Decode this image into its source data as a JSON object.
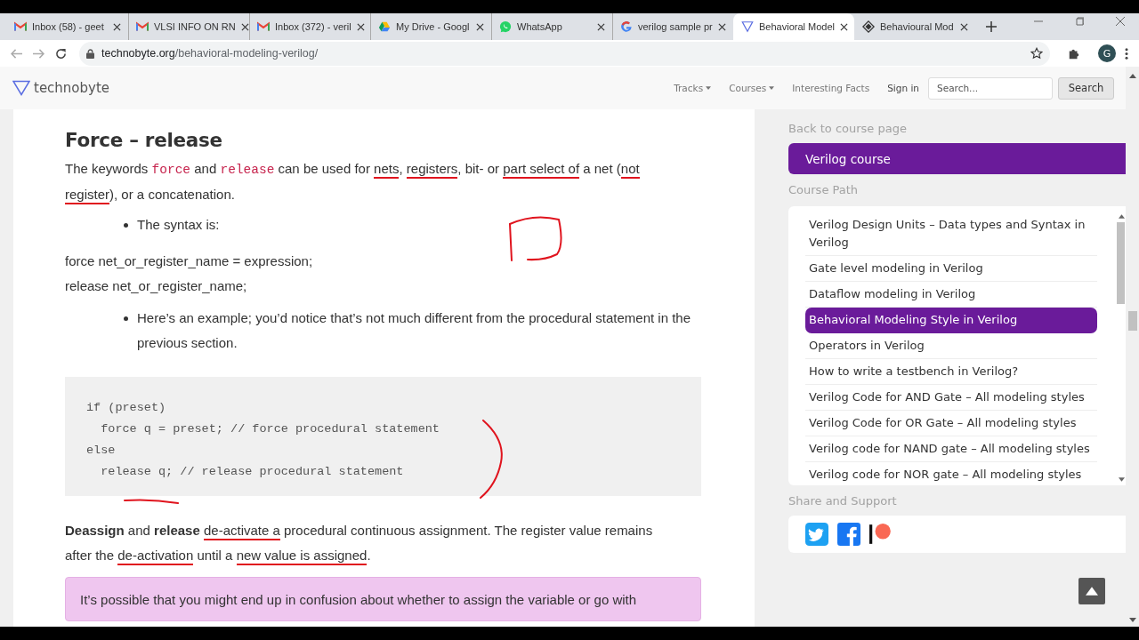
{
  "browser": {
    "tabs": [
      {
        "title": "Inbox (58) - geet",
        "selected": false
      },
      {
        "title": "VLSI INFO ON RN",
        "selected": false
      },
      {
        "title": "Inbox (372) - veril",
        "selected": false
      },
      {
        "title": "My Drive - Googl",
        "selected": false
      },
      {
        "title": "WhatsApp",
        "selected": false
      },
      {
        "title": "verilog sample pr",
        "selected": false
      },
      {
        "title": "Behavioral Model",
        "selected": true
      },
      {
        "title": "Behavioural Mod",
        "selected": false
      }
    ],
    "url": {
      "host": "technobyte.org",
      "path": "/behavioral-modeling-verilog/"
    },
    "profile_initial": "G"
  },
  "site": {
    "logo": "technobyte",
    "nav": [
      {
        "label": "Tracks",
        "dropdown": true
      },
      {
        "label": "Courses",
        "dropdown": true
      },
      {
        "label": "Interesting Facts",
        "dropdown": false
      },
      {
        "label": "Sign in",
        "dropdown": false
      }
    ],
    "search": {
      "placeholder": "Search...",
      "button": "Search"
    }
  },
  "article": {
    "heading": "Force – release",
    "blocks": [
      {
        "kind": "para",
        "segments": [
          {
            "kind": "text",
            "text": "The keywords ",
            "underlined": false
          },
          {
            "kind": "code",
            "text": "force",
            "underlined": false
          },
          {
            "kind": "text",
            "text": " and ",
            "underlined": false
          },
          {
            "kind": "code",
            "text": "release",
            "underlined": false
          },
          {
            "kind": "text",
            "text": " can be used for ",
            "underlined": false
          },
          {
            "kind": "text",
            "text": "nets",
            "underlined": true
          },
          {
            "kind": "text",
            "text": ", ",
            "underlined": false
          },
          {
            "kind": "text",
            "text": "registers",
            "underlined": true
          },
          {
            "kind": "text",
            "text": ", bit- or ",
            "underlined": false
          },
          {
            "kind": "text",
            "text": "part select of",
            "underlined": true
          },
          {
            "kind": "text",
            "text": " a net (",
            "underlined": false
          },
          {
            "kind": "text",
            "text": "not register",
            "underlined": true
          },
          {
            "kind": "text",
            "text": "), or a concatenation.",
            "underlined": false
          }
        ]
      },
      {
        "kind": "bullet",
        "text": "The syntax is:"
      },
      {
        "kind": "lines",
        "lines": [
          "force net_or_register_name = expression;",
          "release net_or_register_name;"
        ]
      },
      {
        "kind": "bullet",
        "text": "Here’s an example; you’d notice that’s not much different from the procedural statement in the previous section."
      },
      {
        "kind": "code",
        "lines": [
          "if (preset)",
          "  force q = preset; // force procedural statement",
          "else",
          "  release q; // release procedural statement"
        ]
      },
      {
        "kind": "para",
        "segments": [
          {
            "kind": "bold",
            "text": "Deassign",
            "underlined": false
          },
          {
            "kind": "text",
            "text": " and ",
            "underlined": false
          },
          {
            "kind": "bold",
            "text": "release ",
            "underlined": false
          },
          {
            "kind": "text",
            "text": "de-activate a",
            "underlined": true
          },
          {
            "kind": "text",
            "text": " procedural continuous assignment. The register value remains after the ",
            "underlined": false
          },
          {
            "kind": "text",
            "text": "de-activation",
            "underlined": true
          },
          {
            "kind": "text",
            "text": " until a ",
            "underlined": false
          },
          {
            "kind": "text",
            "text": "new value is assigned",
            "underlined": true
          },
          {
            "kind": "text",
            "text": ".",
            "underlined": false
          }
        ]
      },
      {
        "kind": "note",
        "text": "It’s possible that you might end up in confusion about whether to assign the variable or go with"
      }
    ]
  },
  "sidebar": {
    "back_link": "Back to course page",
    "course": "Verilog course",
    "path_title": "Course Path",
    "items": [
      {
        "label": "Verilog Design Units – Data types and Syntax in Verilog",
        "selected": false
      },
      {
        "label": "Gate level modeling in Verilog",
        "selected": false
      },
      {
        "label": "Dataflow modeling in Verilog",
        "selected": false
      },
      {
        "label": "Behavioral Modeling Style in Verilog",
        "selected": true
      },
      {
        "label": "Operators in Verilog",
        "selected": false
      },
      {
        "label": "How to write a testbench in Verilog?",
        "selected": false
      },
      {
        "label": "Verilog Code for AND Gate – All modeling styles",
        "selected": false
      },
      {
        "label": "Verilog Code for OR Gate – All modeling styles",
        "selected": false
      },
      {
        "label": "Verilog code for NAND gate – All modeling styles",
        "selected": false
      },
      {
        "label": "Verilog code for NOR gate – All modeling styles",
        "selected": false
      }
    ],
    "share_title": "Share and Support",
    "share": [
      {
        "kind": "twitter"
      },
      {
        "kind": "facebook"
      },
      {
        "kind": "patreon"
      }
    ]
  }
}
